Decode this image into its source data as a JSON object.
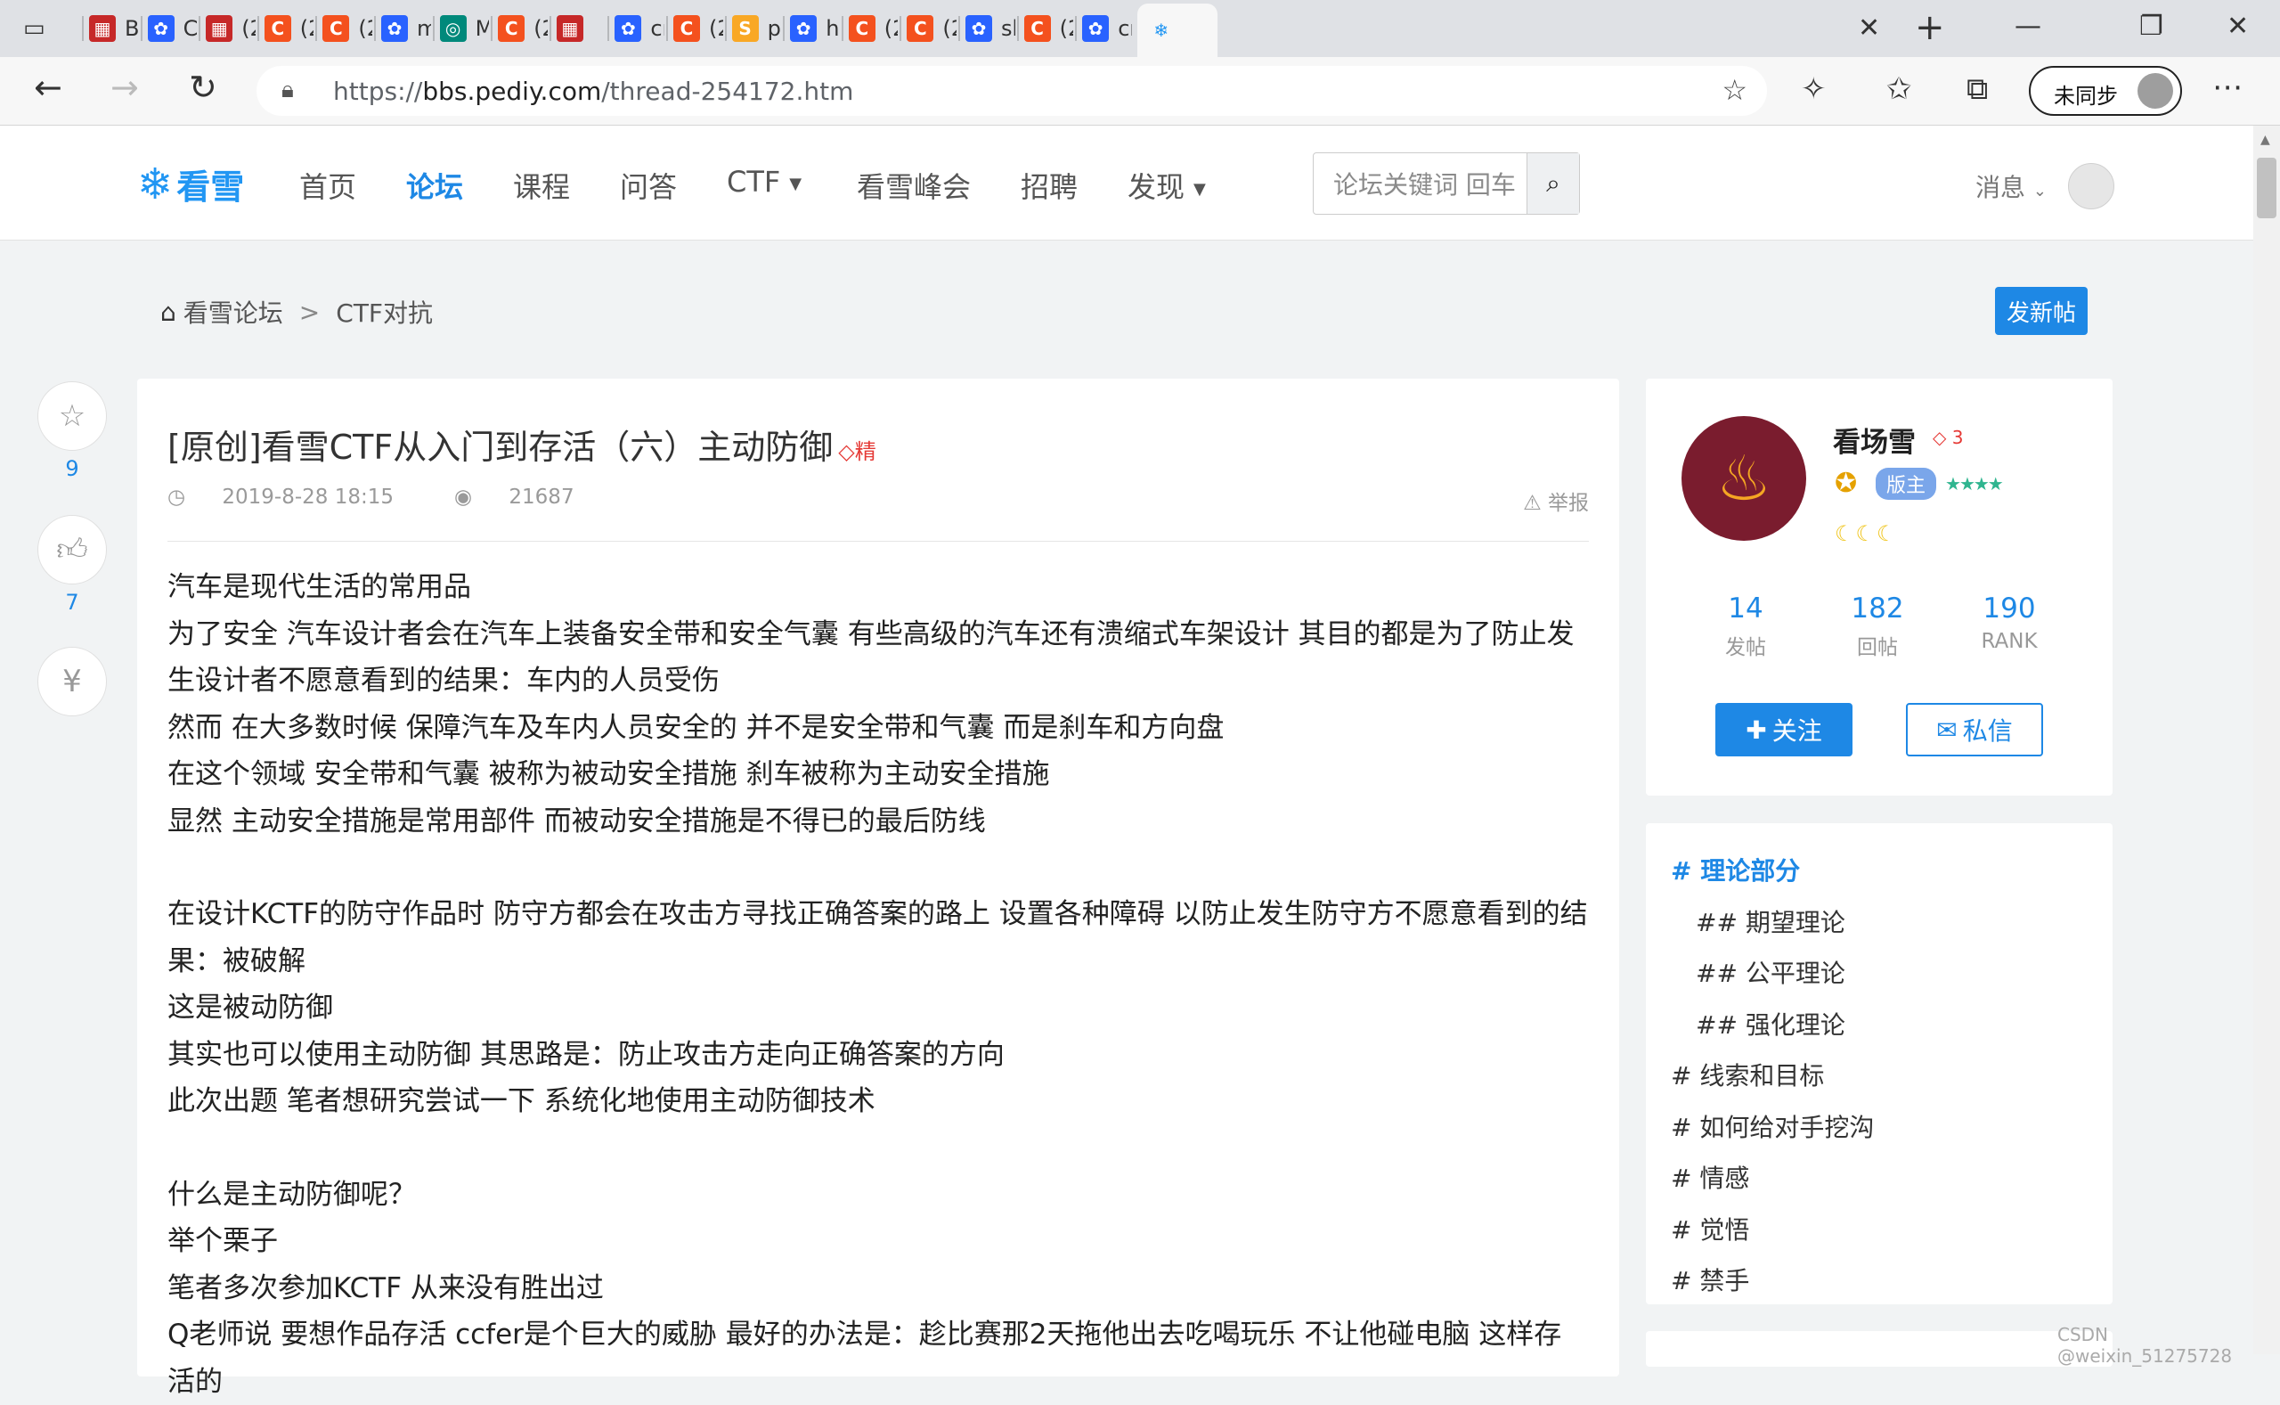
{
  "browser": {
    "tabs": [
      {
        "label": "BU",
        "fav_color": "#c62828",
        "fav_glyph": "▦"
      },
      {
        "label": "Cra",
        "fav_color": "#2962ff",
        "fav_glyph": "✿"
      },
      {
        "label": "(2",
        "fav_color": "#c62828",
        "fav_glyph": "▦"
      },
      {
        "label": "(2",
        "fav_color": "#f4511e",
        "fav_glyph": "C"
      },
      {
        "label": "(2",
        "fav_color": "#f4511e",
        "fav_glyph": "C"
      },
      {
        "label": "md",
        "fav_color": "#2962ff",
        "fav_glyph": "✿"
      },
      {
        "label": "MD",
        "fav_color": "#00897b",
        "fav_glyph": "◎"
      },
      {
        "label": "(2",
        "fav_color": "#f4511e",
        "fav_glyph": "C"
      },
      {
        "label": "【",
        "fav_color": "#c62828",
        "fav_glyph": "▦"
      },
      {
        "label": "cre",
        "fav_color": "#2962ff",
        "fav_glyph": "✿"
      },
      {
        "label": "(2",
        "fav_color": "#f4511e",
        "fav_glyph": "C"
      },
      {
        "label": "pyt",
        "fav_color": "#f9a825",
        "fav_glyph": "S"
      },
      {
        "label": "has",
        "fav_color": "#2962ff",
        "fav_glyph": "✿"
      },
      {
        "label": "(2",
        "fav_color": "#f4511e",
        "fav_glyph": "C"
      },
      {
        "label": "(2",
        "fav_color": "#f4511e",
        "fav_glyph": "C"
      },
      {
        "label": "sha",
        "fav_color": "#2962ff",
        "fav_glyph": "✿"
      },
      {
        "label": "(2",
        "fav_color": "#f4511e",
        "fav_glyph": "C"
      },
      {
        "label": "cry",
        "fav_color": "#2962ff",
        "fav_glyph": "✿"
      }
    ],
    "url_prefix": "https://",
    "url_host": "bbs.pediy.com",
    "url_path": "/thread-254172.htm",
    "sync_label": "未同步"
  },
  "site": {
    "logo_text": "看雪",
    "nav": [
      "首页",
      "论坛",
      "课程",
      "问答",
      "CTF",
      "看雪峰会",
      "招聘",
      "发现"
    ],
    "search_placeholder": "论坛关键词 回车",
    "messages_label": "消息"
  },
  "breadcrumb": {
    "home": "看雪论坛",
    "sep": ">",
    "current": "CTF对抗"
  },
  "new_post_label": "发新帖",
  "float_actions": {
    "favorite_count": "9",
    "like_count": "7"
  },
  "post": {
    "title": "[原创]看雪CTF从入门到存活（六）主动防御",
    "badge": "精",
    "date": "2019-8-28 18:15",
    "views": "21687",
    "report_label": "举报",
    "lines": [
      "汽车是现代生活的常用品",
      "为了安全 汽车设计者会在汽车上装备安全带和安全气囊 有些高级的汽车还有溃缩式车架设计 其目的都是为了防止发",
      "生设计者不愿意看到的结果：车内的人员受伤",
      "然而 在大多数时候 保障汽车及车内人员安全的 并不是安全带和气囊 而是刹车和方向盘",
      "在这个领域 安全带和气囊 被称为被动安全措施 刹车被称为主动安全措施",
      "显然 主动安全措施是常用部件 而被动安全措施是不得已的最后防线",
      "",
      "在设计KCTF的防守作品时 防守方都会在攻击方寻找正确答案的路上 设置各种障碍 以防止发生防守方不愿意看到的结",
      "果：被破解",
      "这是被动防御",
      "其实也可以使用主动防御 其思路是：防止攻击方走向正确答案的方向",
      "此次出题 笔者想研究尝试一下 系统化地使用主动防御技术",
      "",
      "什么是主动防御呢？",
      "举个栗子",
      "笔者多次参加KCTF 从来没有胜出过",
      "Q老师说 要想作品存活 ccfer是个巨大的威胁 最好的办法是：趁比赛那2天拖他出去吃喝玩乐 不让他碰电脑 这样存活的"
    ]
  },
  "author": {
    "name": "看场雪",
    "level": "3",
    "role_badge": "版主",
    "stats": [
      {
        "value": "14",
        "label": "发帖"
      },
      {
        "value": "182",
        "label": "回帖"
      },
      {
        "value": "190",
        "label": "RANK"
      }
    ],
    "follow_label": "关注",
    "pm_label": "私信"
  },
  "toc": [
    {
      "text": "# 理论部分",
      "level": 1,
      "active": true
    },
    {
      "text": "## 期望理论",
      "level": 2,
      "active": false
    },
    {
      "text": "## 公平理论",
      "level": 2,
      "active": false
    },
    {
      "text": "## 强化理论",
      "level": 2,
      "active": false
    },
    {
      "text": "# 线索和目标",
      "level": 1,
      "active": false
    },
    {
      "text": "# 如何给对手挖沟",
      "level": 1,
      "active": false
    },
    {
      "text": "# 情感",
      "level": 1,
      "active": false
    },
    {
      "text": "# 觉悟",
      "level": 1,
      "active": false
    },
    {
      "text": "# 禁手",
      "level": 1,
      "active": false
    }
  ],
  "watermark": "CSDN @weixin_51275728",
  "colors": {
    "accent": "#1e88e5",
    "danger": "#e53935"
  }
}
